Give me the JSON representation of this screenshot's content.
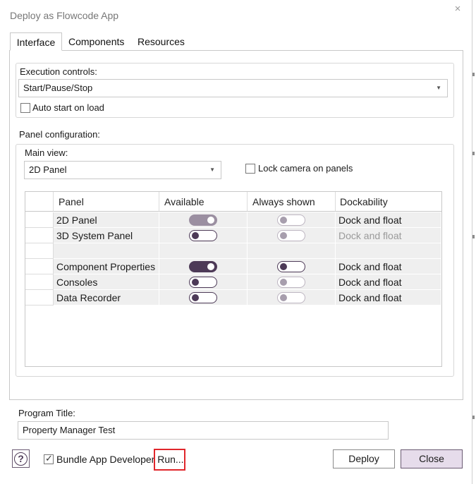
{
  "window": {
    "title": "Deploy as Flowcode App",
    "close_icon": "×"
  },
  "tabs": [
    {
      "label": "Interface",
      "active": true
    },
    {
      "label": "Components",
      "active": false
    },
    {
      "label": "Resources",
      "active": false
    }
  ],
  "execution": {
    "label": "Execution controls:",
    "value": "Start/Pause/Stop",
    "auto_start": {
      "label": "Auto start on load",
      "checked": false
    }
  },
  "panel_config": {
    "label": "Panel configuration:",
    "main_view_label": "Main view:",
    "main_view_value": "2D Panel",
    "lock_camera": {
      "label": "Lock camera on panels",
      "checked": false
    },
    "columns": [
      "Panel",
      "Available",
      "Always shown",
      "Dockability"
    ],
    "rows": [
      {
        "panel": "2D Panel",
        "available": "on-disabled",
        "always_shown": "off-disabled",
        "dockability": "Dock and float",
        "dock_dimmed": false
      },
      {
        "panel": "3D System Panel",
        "available": "off",
        "always_shown": "off-disabled",
        "dockability": "Dock and float",
        "dock_dimmed": true
      },
      {
        "panel": "",
        "available": "",
        "always_shown": "",
        "dockability": "",
        "dock_dimmed": false
      },
      {
        "panel": "Component Properties",
        "available": "on",
        "always_shown": "off",
        "dockability": "Dock and float",
        "dock_dimmed": false
      },
      {
        "panel": "Consoles",
        "available": "off",
        "always_shown": "off-disabled",
        "dockability": "Dock and float",
        "dock_dimmed": false
      },
      {
        "panel": "Data Recorder",
        "available": "off",
        "always_shown": "off-disabled",
        "dockability": "Dock and float",
        "dock_dimmed": false
      }
    ]
  },
  "program": {
    "label": "Program Title:",
    "value": "Property Manager Test"
  },
  "footer": {
    "help_icon": "?",
    "bundle": {
      "label": "Bundle App Developer Run...",
      "checked": true
    },
    "deploy_label": "Deploy",
    "close_label": "Close"
  },
  "colors": {
    "accent": "#4d3a57",
    "accent_light": "#e6dceb",
    "highlight": "#e0262b"
  }
}
